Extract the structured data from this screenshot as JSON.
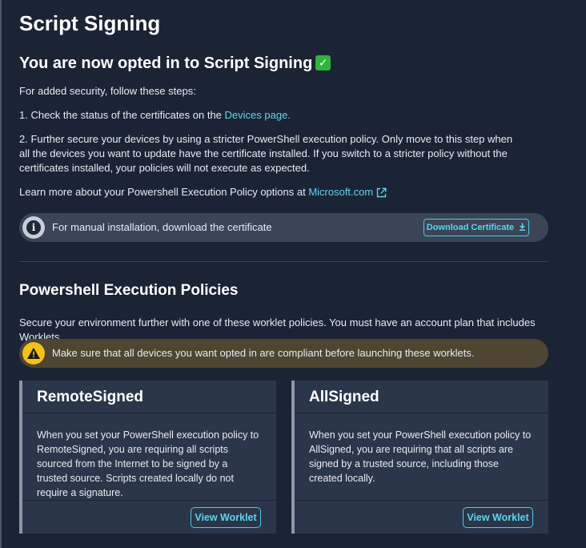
{
  "page": {
    "title": "Script Signing",
    "optin_heading": "You are now opted in to Script Signing",
    "optin_check_glyph": "✓",
    "intro": "For added security, follow these steps:",
    "step1_prefix": "1. Check the status of the certificates on the ",
    "step1_link": "Devices page.",
    "step2": "2. Further secure your devices by using a stricter PowerShell execution policy. Only move to this step when all the devices you want to update have the certificate installed. If you switch to a stricter policy without the certificates installed, your policies will not execute as expected.",
    "learn_prefix": "Learn more about your Powershell Execution Policy options at ",
    "learn_link": "Microsoft.com"
  },
  "info_banner": {
    "icon": "info-icon",
    "icon_glyph": "i",
    "text": "For manual installation, download the certificate",
    "button_label": "Download Certificate"
  },
  "policies": {
    "heading": "Powershell Execution Policies",
    "description": "Secure your environment further with one of these worklet policies. You must have an account plan that includes Worklets.",
    "warning": {
      "icon": "warning-icon",
      "text": "Make sure that all devices you want opted in are compliant before launching these worklets."
    },
    "cards": [
      {
        "title": "RemoteSigned",
        "body": "When you set your PowerShell execution policy to RemoteSigned, you are requiring all scripts sourced from the Internet to be signed by a trusted source. Scripts created locally do not require a signature.",
        "button_label": "View Worklet"
      },
      {
        "title": "AllSigned",
        "body": "When you set your PowerShell execution policy to AllSigned, you are requiring that all scripts are signed by a trusted source, including those created locally.",
        "button_label": "View Worklet"
      }
    ]
  },
  "colors": {
    "background": "#1b2434",
    "accent_link": "#5fd4ee",
    "success": "#2fb43c",
    "warning": "#f2c21a",
    "card": "#2a3649"
  }
}
